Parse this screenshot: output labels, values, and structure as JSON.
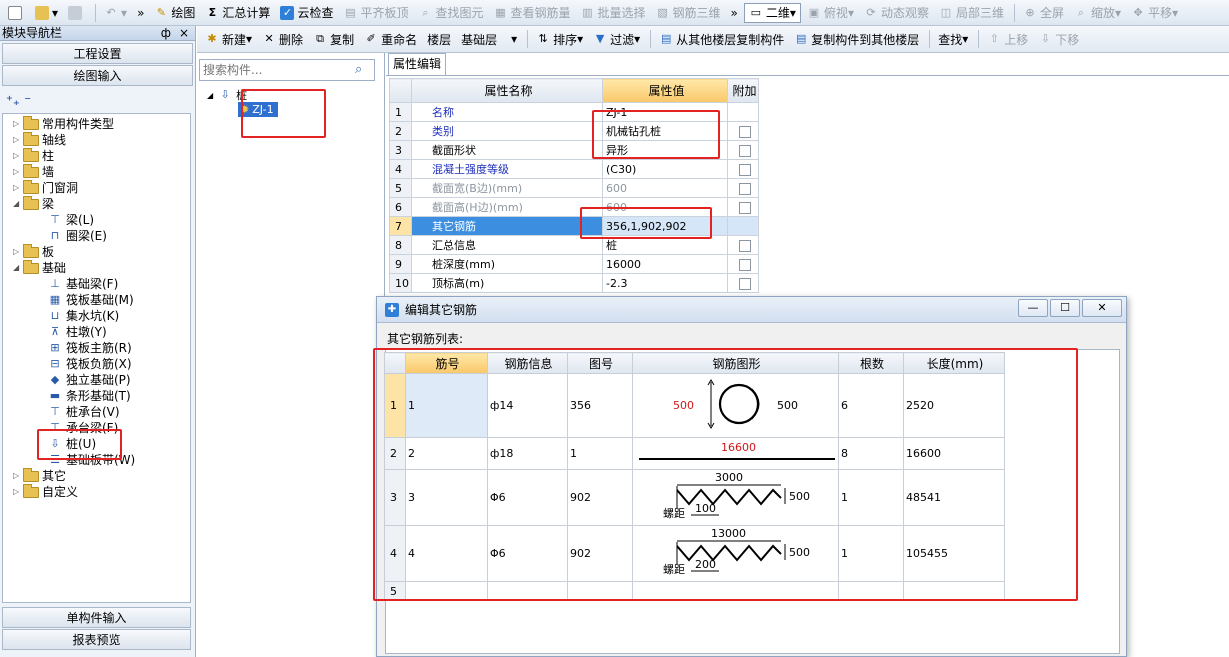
{
  "toolbar": {
    "items": [
      "绘图",
      "汇总计算",
      "云检查",
      "平齐板顶",
      "查找图元",
      "查看钢筋量",
      "批量选择",
      "钢筋三维",
      "二维",
      "俯视",
      "动态观察",
      "局部三维",
      "全屏",
      "缩放",
      "平移"
    ]
  },
  "left_panel": {
    "title": "模块导航栏",
    "pin": "ф",
    "close": "×",
    "btn_project": "工程设置",
    "btn_draw": "绘图输入",
    "btn_single": "单构件输入",
    "btn_report": "报表预览",
    "tree": {
      "common": "常用构件类型",
      "axis": "轴线",
      "column": "柱",
      "wall": "墙",
      "door": "门窗洞",
      "beam": "梁",
      "beam_l": "梁(L)",
      "beam_q": "圈梁(E)",
      "slab": "板",
      "found": "基础",
      "f1": "基础梁(F)",
      "f2": "筏板基础(M)",
      "f3": "集水坑(K)",
      "f4": "柱墩(Y)",
      "f5": "筏板主筋(R)",
      "f6": "筏板负筋(X)",
      "f7": "独立基础(P)",
      "f8": "条形基础(T)",
      "f9": "桩承台(V)",
      "f10": "承台梁(F)",
      "f11": "桩(U)",
      "f12": "基础板带(W)",
      "other": "其它",
      "custom": "自定义"
    }
  },
  "toolbar2": {
    "new": "新建",
    "delete": "删除",
    "copy": "复制",
    "rename": "重命名",
    "floor_label": "楼层",
    "floor_value": "基础层",
    "sort": "排序",
    "filter": "过滤",
    "copy_from": "从其他楼层复制构件",
    "copy_to": "复制构件到其他楼层",
    "find": "查找",
    "up": "上移",
    "down": "下移"
  },
  "mid": {
    "search_placeholder": "搜索构件...",
    "root": "桩",
    "item": "ZJ-1"
  },
  "props": {
    "tab": "属性编辑",
    "headers": [
      "属性名称",
      "属性值",
      "附加"
    ],
    "rows": [
      {
        "n": "1",
        "name": "名称",
        "value": "ZJ-1"
      },
      {
        "n": "2",
        "name": "类别",
        "value": "机械钻孔桩"
      },
      {
        "n": "3",
        "name": "截面形状",
        "value": "异形"
      },
      {
        "n": "4",
        "name": "混凝土强度等级",
        "value": "(C30)"
      },
      {
        "n": "5",
        "name": "截面宽(B边)(mm)",
        "value": "600"
      },
      {
        "n": "6",
        "name": "截面高(H边)(mm)",
        "value": "600"
      },
      {
        "n": "7",
        "name": "其它钢筋",
        "value": "356,1,902,902"
      },
      {
        "n": "8",
        "name": "汇总信息",
        "value": "桩"
      },
      {
        "n": "9",
        "name": "桩深度(mm)",
        "value": "16000"
      },
      {
        "n": "10",
        "name": "顶标高(m)",
        "value": "-2.3"
      }
    ]
  },
  "dialog": {
    "title": "编辑其它钢筋",
    "btn_min": "—",
    "btn_max": "☐",
    "btn_close": "✕",
    "list_label": "其它钢筋列表:",
    "headers": [
      "筋号",
      "钢筋信息",
      "图号",
      "钢筋图形",
      "根数",
      "长度(mm)"
    ],
    "rows": [
      {
        "n": "1",
        "id": "1",
        "info": "ф14",
        "fig": "356",
        "count": "6",
        "len": "2520",
        "shape": {
          "a": "500",
          "b": "500"
        }
      },
      {
        "n": "2",
        "id": "2",
        "info": "ф18",
        "fig": "1",
        "count": "8",
        "len": "16600",
        "shape": {
          "a": "16600"
        }
      },
      {
        "n": "3",
        "id": "3",
        "info": "Φ6",
        "fig": "902",
        "count": "1",
        "len": "48541",
        "shape": {
          "top": "3000",
          "side": "500",
          "pitch_label": "螺距",
          "pitch": "100"
        }
      },
      {
        "n": "4",
        "id": "4",
        "info": "Φ6",
        "fig": "902",
        "count": "1",
        "len": "105455",
        "shape": {
          "top": "13000",
          "side": "500",
          "pitch_label": "螺距",
          "pitch": "200"
        }
      },
      {
        "n": "5",
        "id": "",
        "info": "",
        "fig": "",
        "count": "",
        "len": ""
      }
    ]
  }
}
